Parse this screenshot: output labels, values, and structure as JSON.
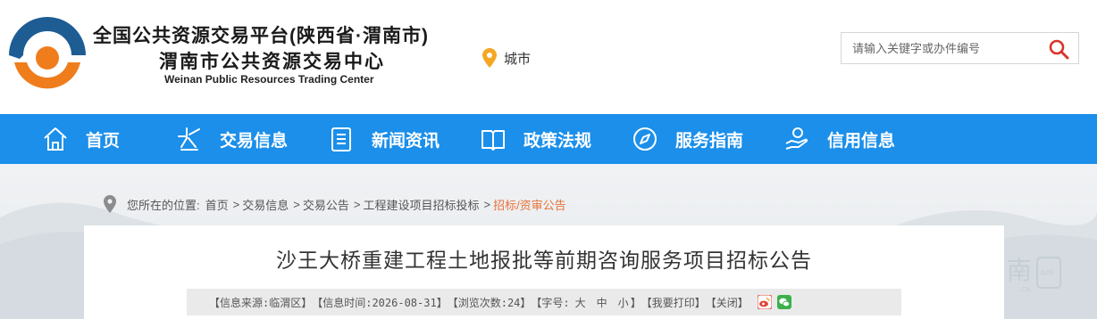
{
  "header": {
    "title": "全国公共资源交易平台(陕西省·渭南市)",
    "subtitle": "渭南市公共资源交易中心",
    "english_name": "Weinan Public Resources Trading Center",
    "city_label": "城市",
    "search_placeholder": "请输入关键字或办件编号",
    "logo_icon": "weinan-logo-icon",
    "location_icon": "map-pin-icon",
    "search_icon": "magnifier-icon"
  },
  "nav": {
    "items": [
      {
        "label": "首页",
        "icon": "home-icon"
      },
      {
        "label": "交易信息",
        "icon": "sparkle-icon"
      },
      {
        "label": "新闻资讯",
        "icon": "document-list-icon"
      },
      {
        "label": "政策法规",
        "icon": "open-book-icon"
      },
      {
        "label": "服务指南",
        "icon": "compass-icon"
      },
      {
        "label": "信用信息",
        "icon": "hand-coin-icon"
      }
    ]
  },
  "breadcrumb": {
    "label": "您所在的位置:",
    "items": [
      "首页",
      "交易信息",
      "交易公告",
      "工程建设项目招标投标",
      "招标/资审公告"
    ],
    "separator": ">"
  },
  "article": {
    "title": "沙王大桥重建工程土地报批等前期咨询服务项目招标公告",
    "meta": {
      "source": "【信息来源:临渭区】",
      "time": "【信息时间:2026-08-31】",
      "views": "【浏览次数:24】",
      "font_label": "【字号:",
      "font_big": "大",
      "font_mid": "中",
      "font_small": "小",
      "font_end": "】",
      "print": "【我要打印】",
      "close": "【关闭】"
    },
    "share": [
      "weibo-icon",
      "wechat-icon"
    ]
  },
  "colors": {
    "nav_bg": "#1b8fea",
    "logo_blue": "#1e5c94",
    "logo_orange": "#ef7d1c",
    "breadcrumb_current": "#e8733a",
    "search_icon": "#d9342b"
  }
}
